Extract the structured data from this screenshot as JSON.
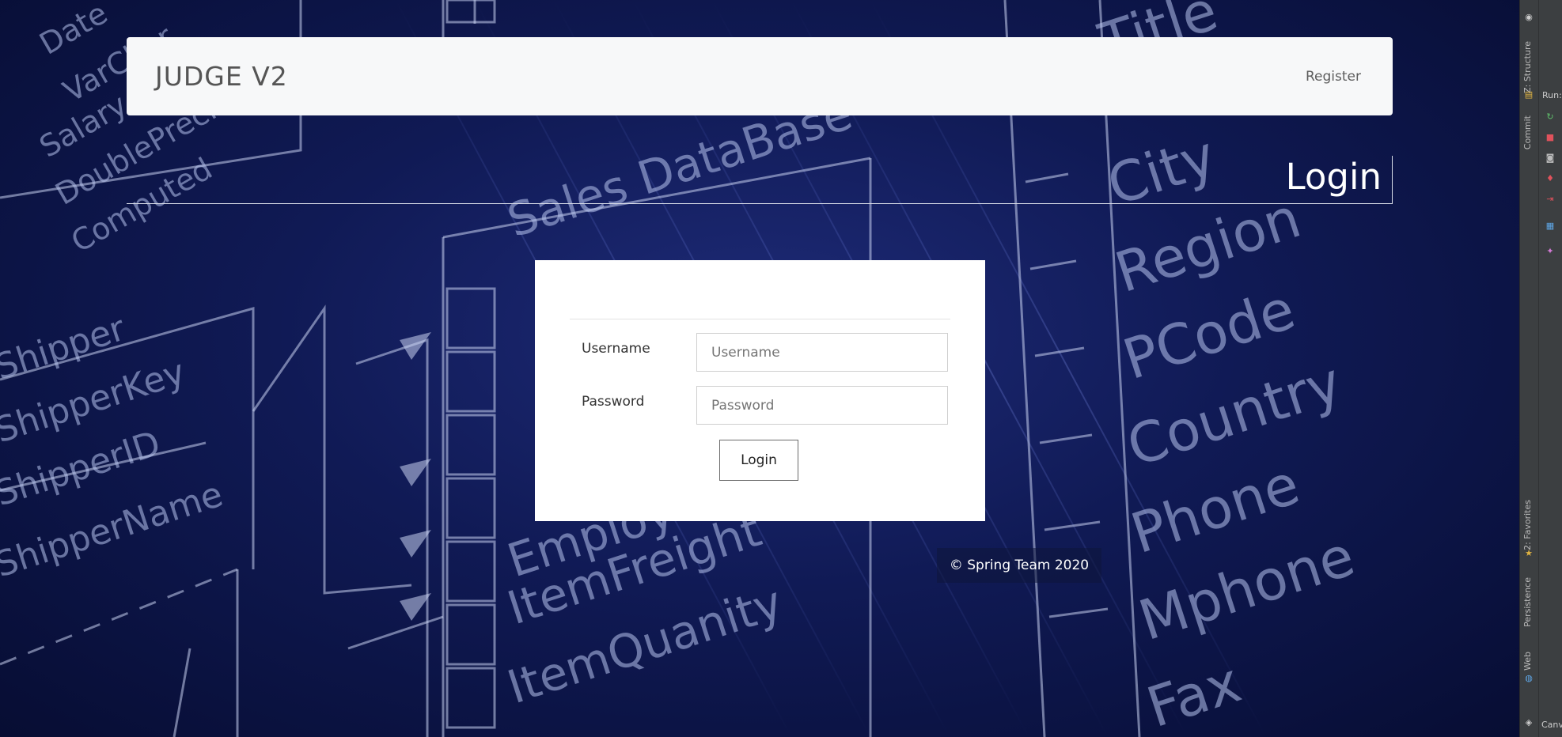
{
  "navbar": {
    "brand": "JUDGE V2",
    "register_link": "Register"
  },
  "page": {
    "heading": "Login"
  },
  "login_form": {
    "username_label": "Username",
    "username_placeholder": "Username",
    "password_label": "Password",
    "password_placeholder": "Password",
    "submit_label": "Login"
  },
  "footer": {
    "copyright": "© Spring Team 2020"
  },
  "background": {
    "words": [
      "Sales DataBase",
      "City",
      "Region",
      "PCode",
      "Country",
      "Phone",
      "Mphone",
      "Fax",
      "Title",
      "ShipperKey",
      "ShipperID",
      "ShipperName",
      "Shipper",
      "ItemFreight",
      "ItemQuanity",
      "Employee",
      "Computed",
      "DoublePrecision",
      "Salary",
      "VarChar",
      "Date"
    ]
  },
  "ide_panel": {
    "tabs": [
      "Z: Structure",
      "Commit",
      "2: Favorites",
      "Persistence",
      "Web"
    ],
    "run_label": "Run:",
    "bottom_label": "Canv"
  },
  "colors": {
    "navbar_bg": "#f7f8f9",
    "page_bg": "#101a55",
    "card_bg": "#ffffff"
  }
}
